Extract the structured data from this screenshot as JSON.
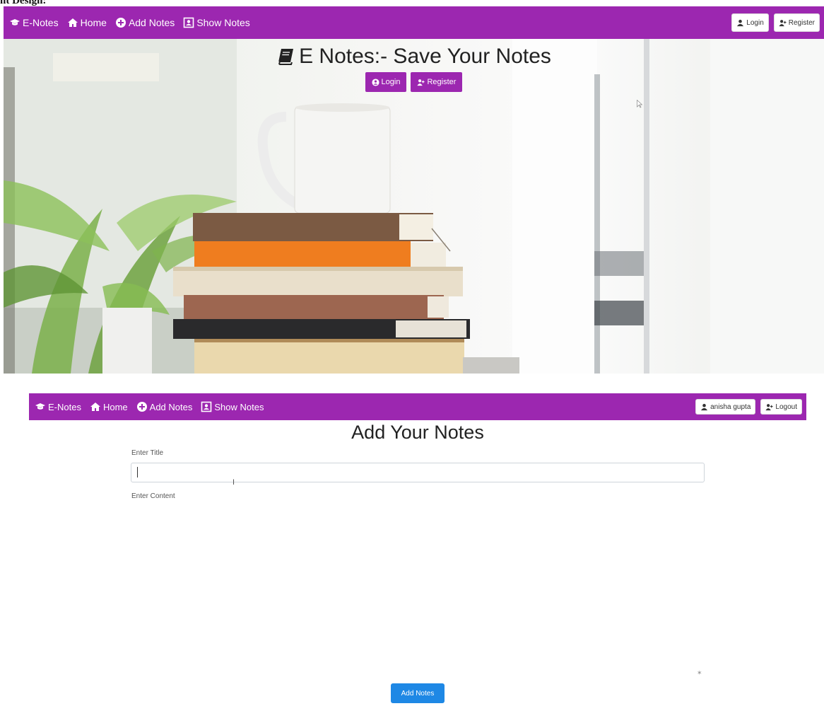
{
  "caption": "nt Design:",
  "navbar_top": {
    "brand": "E-Notes",
    "links": [
      "Home",
      "Add Notes",
      "Show Notes"
    ],
    "login_label": "Login",
    "register_label": "Register"
  },
  "hero": {
    "title": "E Notes:- Save Your Notes",
    "login_label": "Login",
    "register_label": "Register"
  },
  "navbar_bottom": {
    "brand": "E-Notes",
    "links": [
      "Home",
      "Add Notes",
      "Show Notes"
    ],
    "user_label": "anisha gupta",
    "logout_label": "Logout"
  },
  "form": {
    "heading": "Add Your Notes",
    "title_label": "Enter Title",
    "content_label": "Enter Content",
    "title_value": "",
    "content_value": "",
    "submit_label": "Add Notes"
  },
  "colors": {
    "navbar": "#9c27b0",
    "submit": "#1e88e5"
  }
}
